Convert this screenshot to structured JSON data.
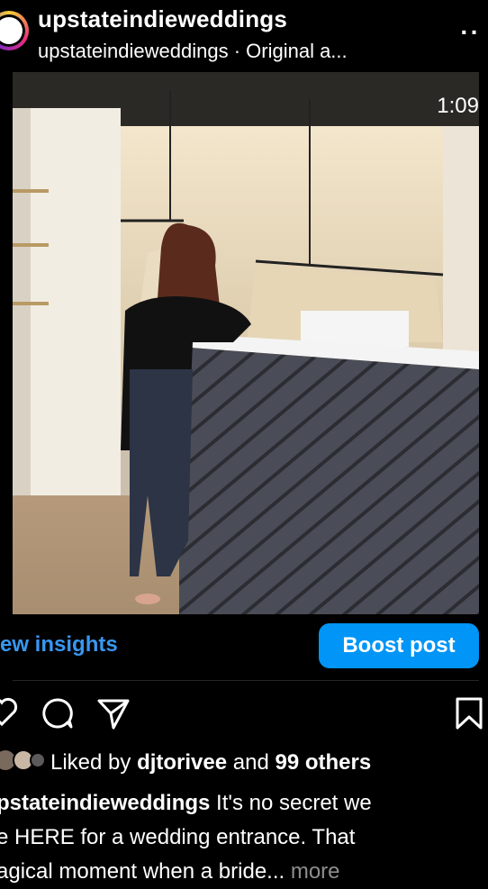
{
  "header": {
    "username": "upstateindieweddings",
    "audio_line": "upstateindieweddings · Original a...",
    "more_icon": "more-dots-icon"
  },
  "video": {
    "timestamp": "1:09",
    "mute_icon": "speaker-muted-icon"
  },
  "actions": {
    "insights_label": "ew insights",
    "boost_label": "Boost post",
    "icons": [
      "heart-icon",
      "comment-icon",
      "share-icon",
      "bookmark-icon"
    ]
  },
  "likes": {
    "prefix": "Liked by",
    "user": "djtorivee",
    "connector": "and",
    "others": "99 others"
  },
  "caption": {
    "username": "pstateindieweddings",
    "line1_text": "It's no secret we",
    "line2": "e HERE for a wedding entrance. That",
    "line3": "agical moment when a bride...",
    "more": "more"
  },
  "colors": {
    "background": "#000000",
    "accent": "#0095f6",
    "link": "#3897f0",
    "muted": "#8e8e8e"
  }
}
